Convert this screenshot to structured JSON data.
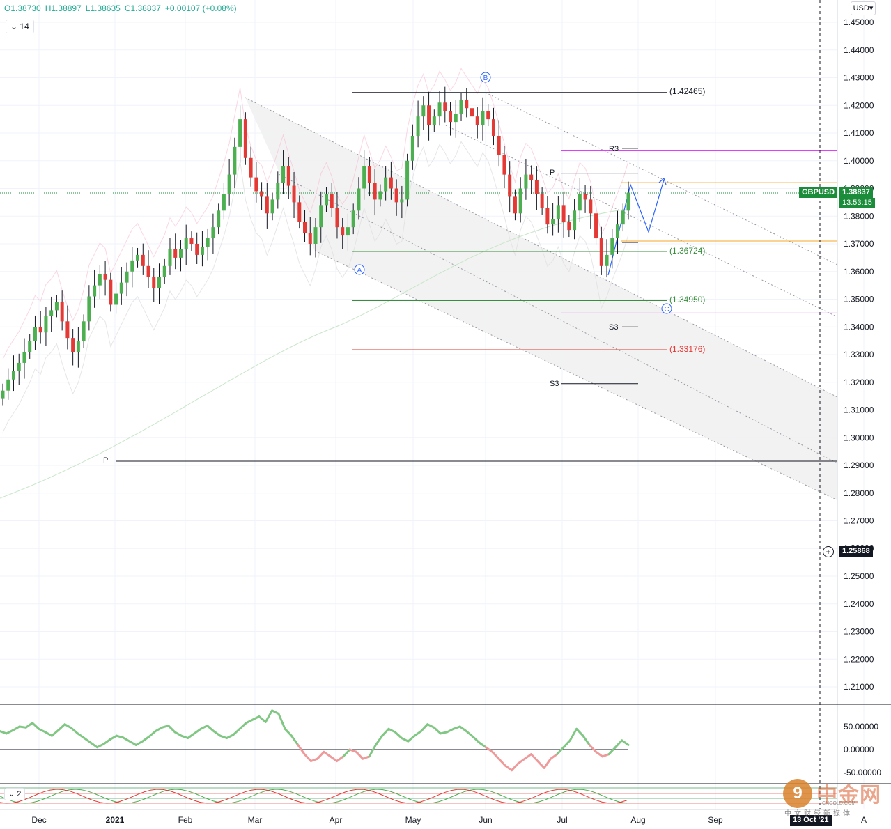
{
  "header": {
    "open": "O1.38730",
    "high": "H1.38897",
    "low": "L1.38635",
    "close": "C1.38837",
    "change": "+0.00107 (+0.08%)",
    "interval": "14",
    "currency": "USD"
  },
  "indicator_pane": {
    "label": "2"
  },
  "colors": {
    "up": "#4caf50",
    "down": "#e53935",
    "pitchfork_fill": "#f0f0f0",
    "pitchfork_line": "#9598a1",
    "magenta": "#e040fb",
    "orange": "#f5a623",
    "projection": "#2962ff",
    "cci_up": "#81c784",
    "cci_down": "#ef9a9a"
  },
  "watermark": {
    "name": "中金网",
    "sub": "中文财经新媒体",
    "domain": "CNGOLD.COM"
  },
  "chart_data": [
    {
      "type": "candlestick",
      "symbol": "GBPUSD",
      "price_tag": "1.38837",
      "countdown": "13:53:15",
      "crosshair_price": "1.25868",
      "crosshair_time": "13 Oct '21",
      "y_axis": {
        "range": [
          1.2,
          1.4595
        ],
        "ticks": [
          "1.45000",
          "1.44000",
          "1.43000",
          "1.42000",
          "1.41000",
          "1.40000",
          "1.39000",
          "1.38000",
          "1.37000",
          "1.36000",
          "1.35000",
          "1.34000",
          "1.33000",
          "1.32000",
          "1.31000",
          "1.30000",
          "1.29000",
          "1.28000",
          "1.27000",
          "1.26000",
          "1.25000",
          "1.24000",
          "1.23000",
          "1.22000",
          "1.21000"
        ]
      },
      "x_axis": {
        "ticks": [
          "Dec",
          "2021",
          "Feb",
          "Mar",
          "Apr",
          "May",
          "Jun",
          "Jul",
          "Aug",
          "Sep",
          "A"
        ]
      },
      "grid": true,
      "closes": [
        1.317,
        1.321,
        1.324,
        1.327,
        1.331,
        1.335,
        1.34,
        1.338,
        1.344,
        1.346,
        1.349,
        1.342,
        1.336,
        1.331,
        1.335,
        1.342,
        1.351,
        1.355,
        1.359,
        1.357,
        1.348,
        1.352,
        1.356,
        1.36,
        1.364,
        1.366,
        1.362,
        1.358,
        1.354,
        1.358,
        1.362,
        1.368,
        1.365,
        1.368,
        1.372,
        1.37,
        1.366,
        1.369,
        1.372,
        1.376,
        1.382,
        1.388,
        1.395,
        1.405,
        1.415,
        1.401,
        1.394,
        1.389,
        1.387,
        1.381,
        1.386,
        1.392,
        1.398,
        1.391,
        1.385,
        1.378,
        1.374,
        1.37,
        1.376,
        1.384,
        1.388,
        1.383,
        1.376,
        1.373,
        1.376,
        1.382,
        1.39,
        1.398,
        1.392,
        1.386,
        1.389,
        1.394,
        1.39,
        1.385,
        1.386,
        1.4,
        1.409,
        1.416,
        1.42,
        1.413,
        1.416,
        1.421,
        1.418,
        1.414,
        1.417,
        1.422,
        1.419,
        1.416,
        1.413,
        1.418,
        1.415,
        1.409,
        1.402,
        1.395,
        1.387,
        1.381,
        1.39,
        1.395,
        1.393,
        1.388,
        1.383,
        1.377,
        1.379,
        1.384,
        1.378,
        1.375,
        1.382,
        1.388,
        1.386,
        1.381,
        1.372,
        1.362,
        1.366,
        1.372,
        1.377,
        1.382,
        1.3884
      ]
    },
    {
      "type": "line",
      "name": "oscillator",
      "y_axis": {
        "range": [
          -60,
          110
        ],
        "ticks": [
          "50.00000",
          "0.00000",
          "-50.00000"
        ]
      },
      "values": [
        40,
        35,
        42,
        50,
        48,
        58,
        45,
        38,
        30,
        42,
        55,
        47,
        35,
        25,
        15,
        5,
        12,
        22,
        30,
        26,
        18,
        10,
        18,
        28,
        40,
        48,
        52,
        38,
        30,
        25,
        35,
        45,
        52,
        40,
        30,
        25,
        32,
        45,
        58,
        65,
        72,
        60,
        85,
        78,
        45,
        30,
        10,
        -10,
        -25,
        -20,
        -5,
        -15,
        -25,
        -15,
        0,
        -5,
        -20,
        -15,
        10,
        30,
        45,
        38,
        25,
        18,
        30,
        40,
        55,
        48,
        35,
        38,
        45,
        50,
        40,
        28,
        15,
        5,
        -5,
        -20,
        -35,
        -45,
        -30,
        -20,
        -10,
        -25,
        -40,
        -20,
        -10,
        5,
        20,
        45,
        30,
        10,
        -5,
        -15,
        -10,
        5,
        20,
        10
      ]
    }
  ],
  "annotations": {
    "wave_labels": [
      "B",
      "A",
      "C"
    ],
    "fib_levels": [
      "(1.42465)",
      "(1.36724)",
      "(1.34950)",
      "(1.33176)"
    ],
    "pivots": [
      "R3",
      "P",
      "S3",
      "S3",
      "P"
    ]
  }
}
